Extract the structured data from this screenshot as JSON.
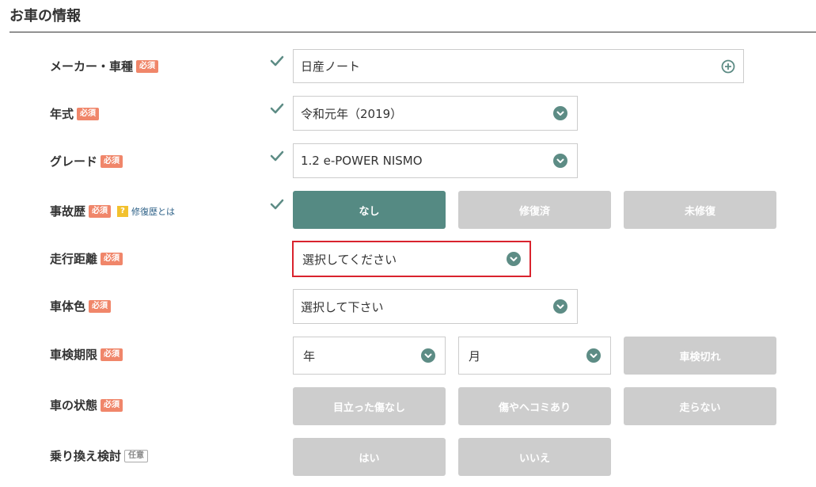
{
  "section_title": "お車の情報",
  "required_badge": "必須",
  "optional_badge": "任意",
  "rows": {
    "maker": {
      "label": "メーカー・車種",
      "value": "日産ノート",
      "icon": "plus-circle-icon"
    },
    "year": {
      "label": "年式",
      "value": "令和元年（2019）"
    },
    "grade": {
      "label": "グレード",
      "value": "1.2 e-POWER NISMO"
    },
    "accident": {
      "label": "事故歴",
      "help_mark": "?",
      "help_link": "修復歴とは",
      "options": [
        "なし",
        "修復済",
        "未修復"
      ],
      "selected": "なし"
    },
    "mileage": {
      "label": "走行距離",
      "value": "選択してください"
    },
    "color": {
      "label": "車体色",
      "value": "選択して下さい"
    },
    "inspection": {
      "label": "車検期限",
      "year_value": "年",
      "month_value": "月",
      "expired_button": "車検切れ"
    },
    "condition": {
      "label": "車の状態",
      "options": [
        "目立った傷なし",
        "傷やヘコミあり",
        "走らない"
      ]
    },
    "replacement": {
      "label": "乗り換え検討",
      "options": [
        "はい",
        "いいえ"
      ]
    }
  },
  "colors": {
    "accent": "#558a83",
    "required_badge": "#f0866a",
    "error_border": "#d9232e",
    "disabled_button": "#cdcdcd",
    "help_icon": "#f2c12e"
  }
}
